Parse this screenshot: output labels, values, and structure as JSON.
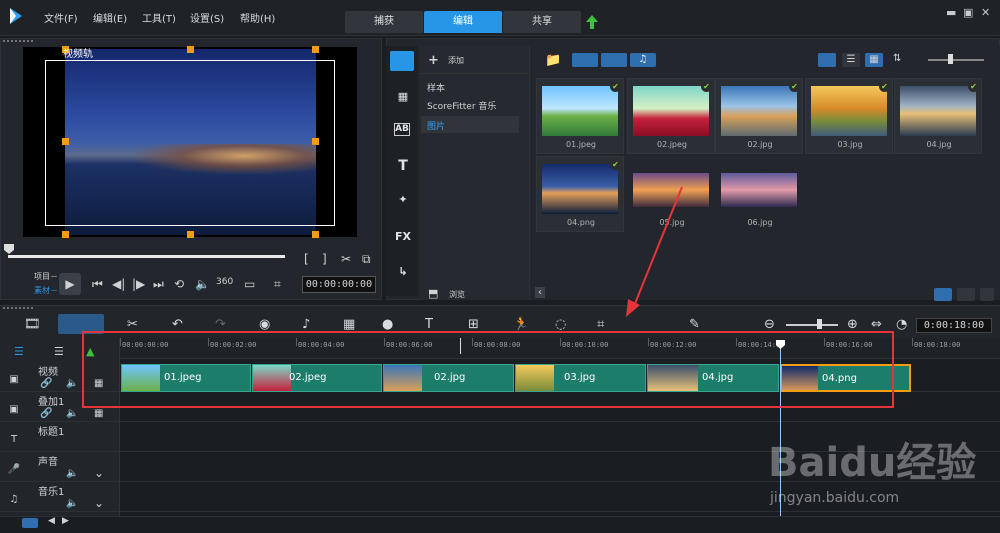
{
  "menu": {
    "items": [
      "文件(F)",
      "编辑(E)",
      "工具(T)",
      "设置(S)",
      "帮助(H)"
    ]
  },
  "tabs": [
    "捕获",
    "编辑",
    "共享"
  ],
  "preview": {
    "track_label": "视频轨",
    "mode_project": "项目－",
    "mode_clip": "素材－",
    "timecode": "00:00:00:00"
  },
  "library": {
    "add_label": "添加",
    "folders": [
      "样本",
      "ScoreFitter 音乐",
      "图片"
    ],
    "browse_label": "浏览",
    "thumbnails": [
      {
        "label": "01.jpeg",
        "checked": true
      },
      {
        "label": "02.jpeg",
        "checked": true
      },
      {
        "label": "02.jpg",
        "checked": true
      },
      {
        "label": "03.jpg",
        "checked": true
      },
      {
        "label": "04.jpg",
        "checked": true
      },
      {
        "label": "04.png",
        "checked": true
      },
      {
        "label": "05.jpg",
        "checked": false
      },
      {
        "label": "06.jpg",
        "checked": false
      }
    ]
  },
  "timeline": {
    "timecode": "0:00:18:00",
    "ticks": [
      "00:00:00:00",
      "00:00:02:00",
      "00:00:04:00",
      "00:00:06:00",
      "00:00:08:00",
      "00:00:10:00",
      "00:00:12:00",
      "00:00:14:00",
      "00:00:16:00",
      "00:00:18:00"
    ],
    "tracks": [
      "视频",
      "叠加1",
      "标题1",
      "声音",
      "音乐1"
    ],
    "clips": [
      "01.jpeg",
      "02.jpeg",
      "02.jpg",
      "03.jpg",
      "04.jpg",
      "04.png"
    ]
  },
  "colors": {
    "accent": "#2796e6",
    "clip": "#1c7d6b",
    "selection": "#f39c12",
    "annotation": "#e5343a"
  },
  "watermark": {
    "brand": "Baidu经验",
    "url": "jingyan.baidu.com"
  }
}
